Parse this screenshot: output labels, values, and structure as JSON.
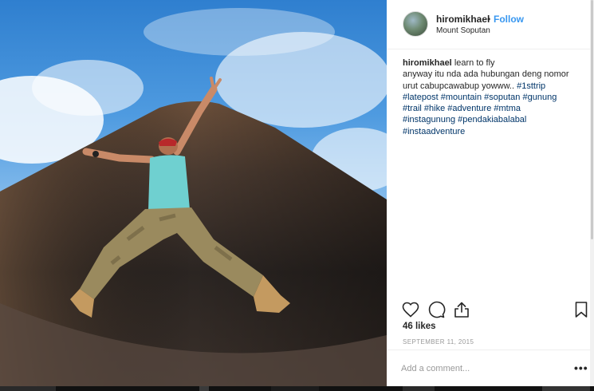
{
  "post": {
    "username": "hiromikhael",
    "separator": "•",
    "follow_label": "Follow",
    "location": "Mount Soputan",
    "caption": {
      "username": "hiromikhael",
      "line1": "learn to fly",
      "line2": "anyway itu nda ada hubungan deng nomor",
      "line3": "urut cabupcawabup yowww..",
      "hashtags": [
        "#1sttrip",
        "#latepost",
        "#mountain",
        "#soputan",
        "#gunung",
        "#trail",
        "#hike",
        "#adventure",
        "#mtma",
        "#instagunung",
        "#pendakiabalabal",
        "#instaadventure"
      ]
    },
    "likes": "46 likes",
    "date": "SEPTEMBER 11, 2015",
    "comment_placeholder": "Add a comment...",
    "more_label": "•••"
  },
  "icons": {
    "like": "heart-icon",
    "comment": "comment-icon",
    "share": "share-icon",
    "save": "bookmark-icon",
    "more": "more-options-icon"
  },
  "colors": {
    "link": "#003569",
    "follow": "#3897f0",
    "text": "#262626",
    "muted": "#999999"
  }
}
